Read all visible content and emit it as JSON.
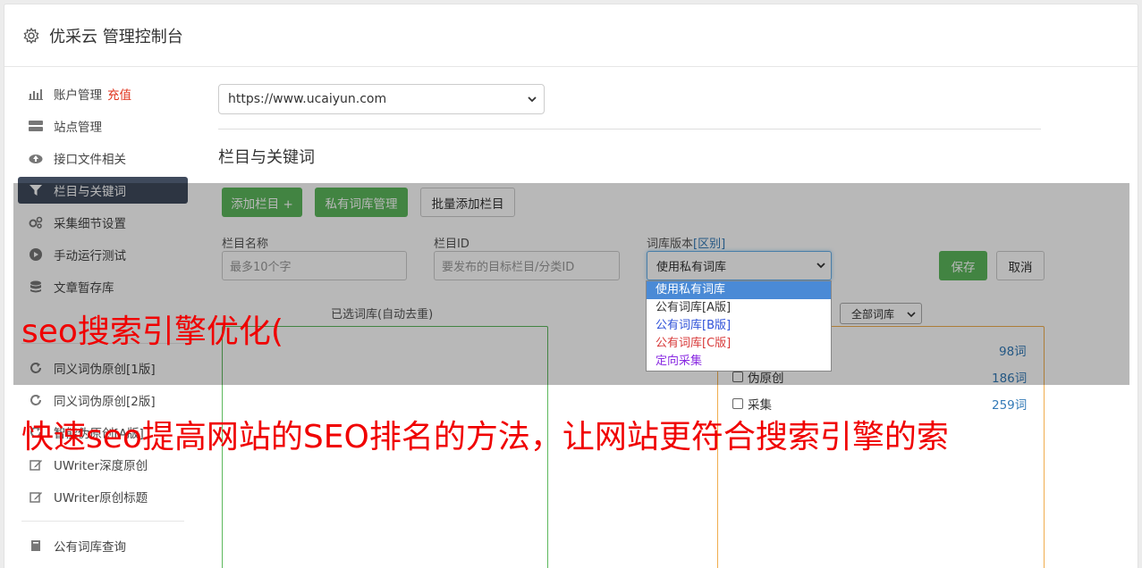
{
  "header": {
    "title": "优采云 管理控制台",
    "icon": "gear-icon"
  },
  "sidebar": {
    "items": [
      {
        "label": "账户管理",
        "icon": "bar-chart-icon",
        "badge": "充值"
      },
      {
        "label": "站点管理",
        "icon": "server-icon"
      },
      {
        "label": "接口文件相关",
        "icon": "cloud-upload-icon"
      },
      {
        "label": "栏目与关键词",
        "icon": "filter-icon",
        "active": true
      },
      {
        "label": "采集细节设置",
        "icon": "gears-icon"
      },
      {
        "label": "手动运行测试",
        "icon": "play-circle-icon"
      },
      {
        "label": "文章暂存库",
        "icon": "database-icon"
      },
      {
        "label": "同义词伪原创[1版]",
        "icon": "refresh-icon"
      },
      {
        "label": "同义词伪原创[2版]",
        "icon": "refresh-icon"
      },
      {
        "label": "智能伪原创[A版]",
        "icon": "refresh-icon"
      },
      {
        "label": "UWriter深度原创",
        "icon": "edit-icon"
      },
      {
        "label": "UWriter原创标题",
        "icon": "edit-icon"
      },
      {
        "label": "公有词库查询",
        "icon": "book-icon"
      }
    ]
  },
  "main": {
    "site_select_value": "https://www.ucaiyun.com",
    "section_title": "栏目与关键词",
    "buttons": {
      "add_column": "添加栏目 +",
      "private_lib": "私有词库管理",
      "batch_add": "批量添加栏目",
      "save": "保存",
      "cancel": "取消"
    },
    "fields": {
      "name_label": "栏目名称",
      "name_placeholder": "最多10个字",
      "id_label": "栏目ID",
      "id_placeholder": "要发布的目标栏目/分类ID",
      "version_label": "词库版本",
      "version_link": "[区别]",
      "version_value": "使用私有词库"
    },
    "version_options": [
      "使用私有词库",
      "公有词库[A版]",
      "公有词库[B版]",
      "公有词库[C版]",
      "定向采集"
    ],
    "selected_lib_label": "已选词库(自动去重)",
    "filter_select": "全部词库",
    "libraries": [
      {
        "name": "",
        "count": "98词"
      },
      {
        "name": "伪原创",
        "count": "186词"
      },
      {
        "name": "采集",
        "count": "259词"
      }
    ]
  },
  "watermark": {
    "line1": "seo搜索引擎优化(",
    "line2": "快速seo提高网站的SEO排名的方法，让网站更符合搜索引擎的索"
  },
  "colors": {
    "accent_green": "#5cb85c",
    "active_nav": "#3f4a5c",
    "link_blue": "#337ab7",
    "overlay_red": "#f00000"
  }
}
